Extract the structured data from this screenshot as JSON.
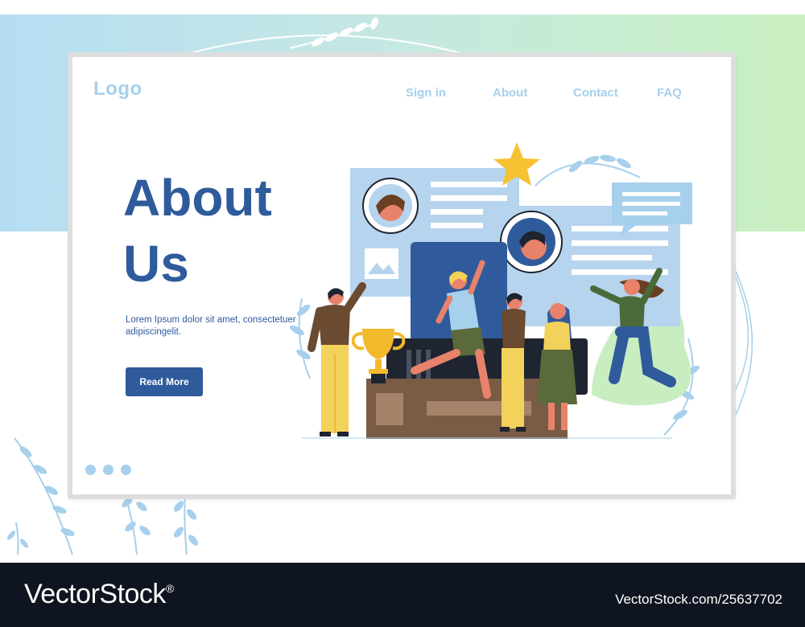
{
  "header": {
    "logo": "Logo",
    "nav": [
      "Sign in",
      "About",
      "Contact",
      "FAQ"
    ]
  },
  "hero": {
    "title_line1": "About",
    "title_line2": "Us",
    "description": "Lorem Ipsum dolor sit amet, consectetuer adipiscingelit.",
    "cta_label": "Read More"
  },
  "carousel": {
    "dot_count": 3
  },
  "watermark": {
    "brand": "VectorStock",
    "mark": "®",
    "image_id": "VectorStock.com/25637702"
  },
  "colors": {
    "primary": "#2f5b9c",
    "muted": "#a6d0ec",
    "footer_bg": "#0f1520",
    "band_left": "#b6def3",
    "band_right": "#c9efc0"
  }
}
